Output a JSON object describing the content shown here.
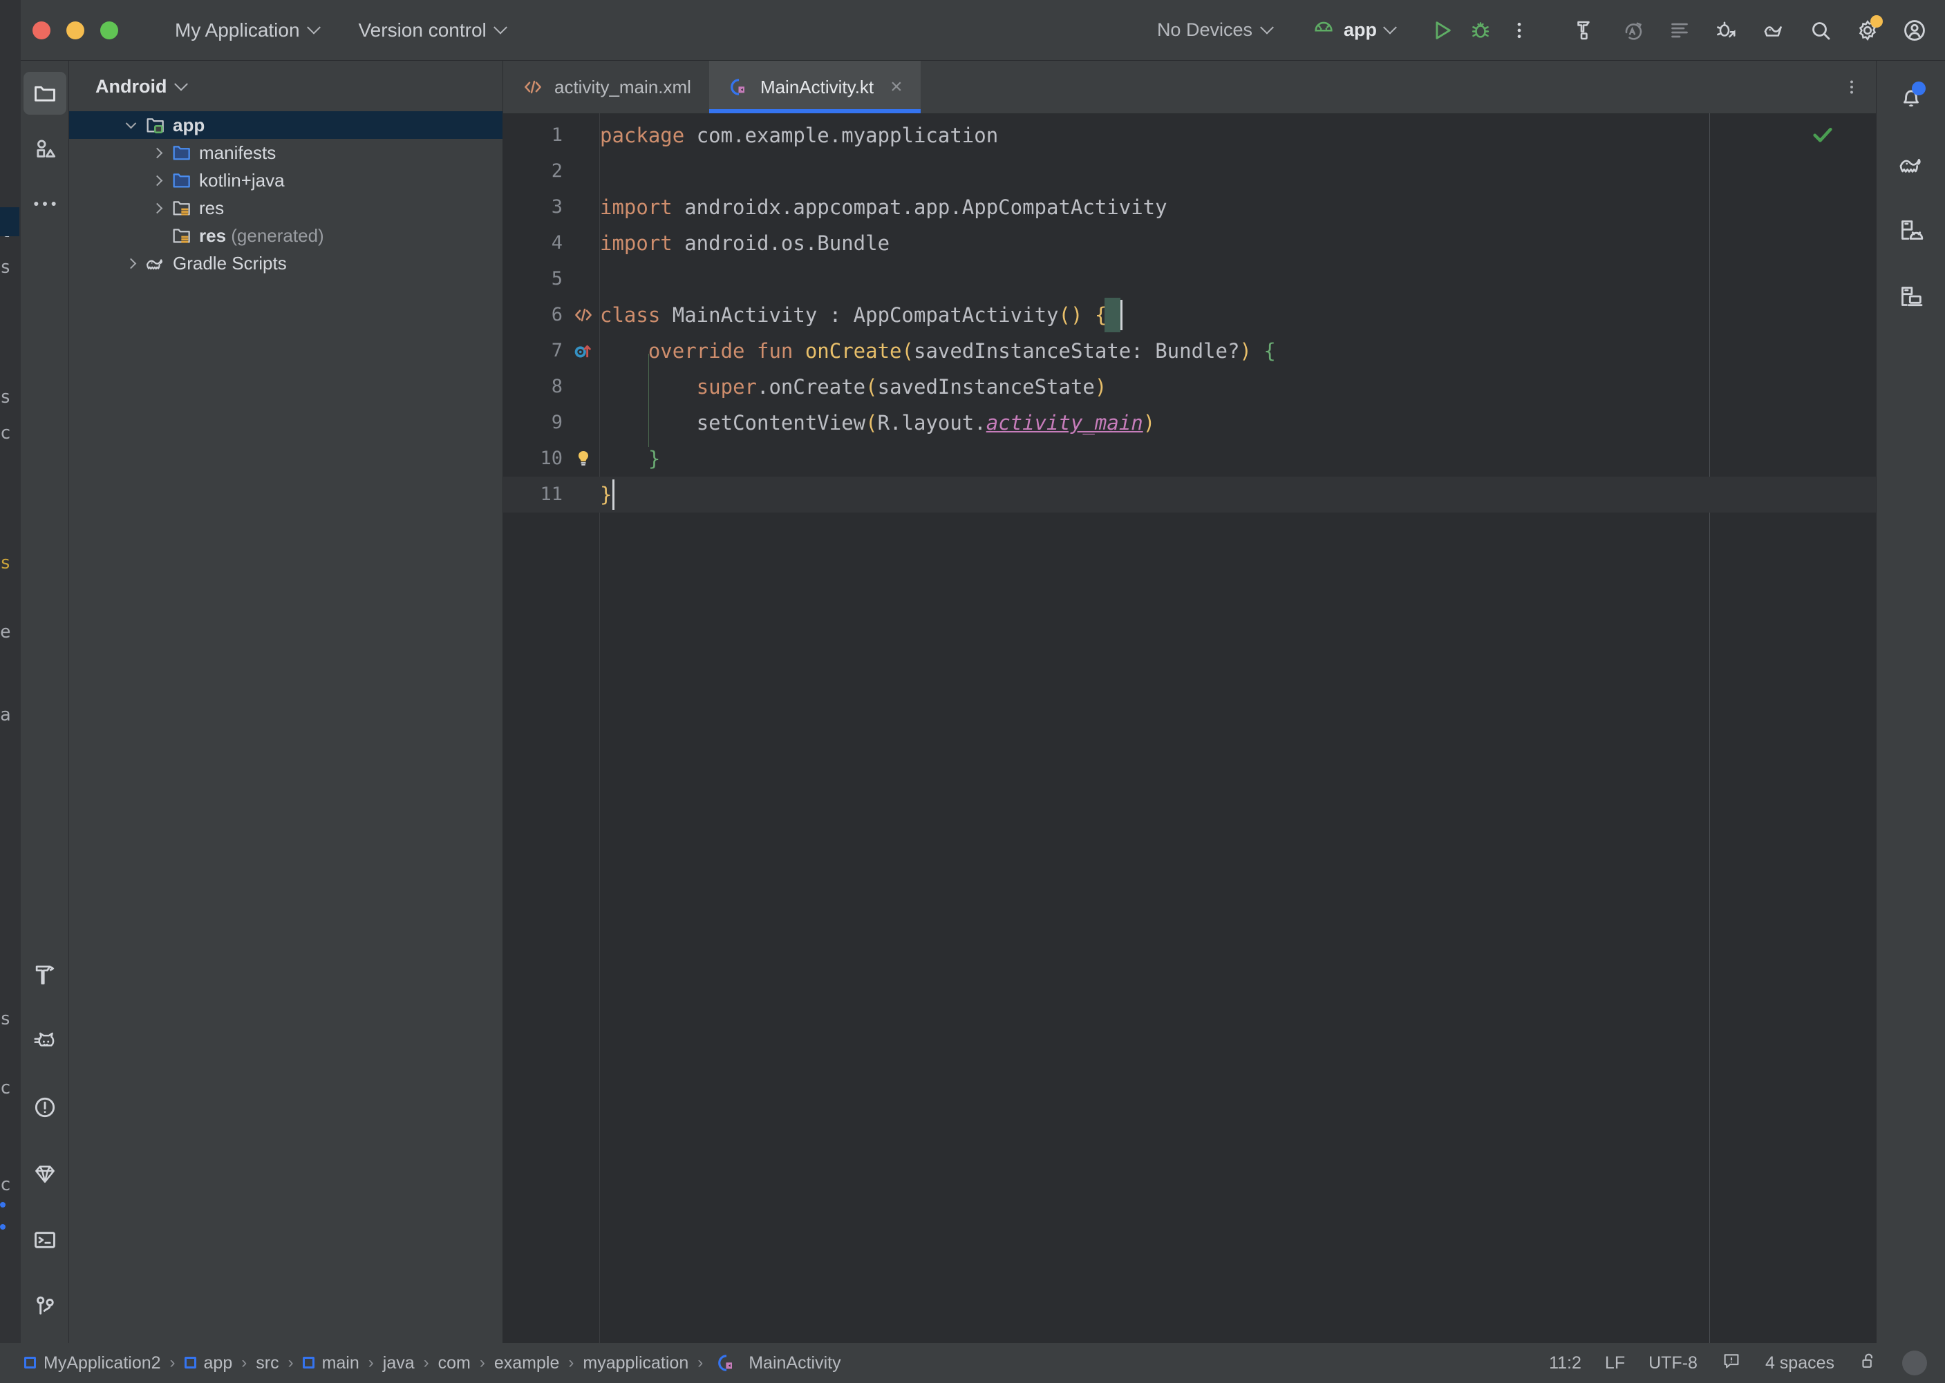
{
  "window": {
    "traffic_lights": [
      "close",
      "minimize",
      "maximize"
    ],
    "project_menu": "My Application",
    "vcs_menu": "Version control"
  },
  "toolbar": {
    "device_selector": "No Devices",
    "run_config": "app",
    "run_label": "Run",
    "debug_label": "Debug",
    "more_label": "More actions",
    "icons": [
      "build-icon",
      "apply-changes-icon",
      "logcat-icon",
      "debug-bridge-icon",
      "device-manager-icon",
      "search-icon",
      "settings-icon",
      "account-icon"
    ],
    "colors": {
      "run_green": "#5fad65",
      "accent_blue": "#3574f0",
      "badge_yellow": "#f5bd4f"
    }
  },
  "left_activity_bar": {
    "top": [
      "project-icon",
      "resource-manager-icon",
      "more-tool-windows-icon"
    ],
    "bottom": [
      "build-icon",
      "logcat-icon",
      "problems-icon",
      "profiler-icon",
      "terminal-icon",
      "version-control-icon"
    ],
    "selected": "project-icon"
  },
  "right_activity_bar": {
    "items": [
      "notifications-icon",
      "gradle-icon",
      "device-manager-icon",
      "running-devices-icon"
    ],
    "notification_badge": true,
    "badge_color": "#3574f0"
  },
  "project_panel": {
    "title": "Android",
    "tree": [
      {
        "label": "app",
        "icon": "module-folder-icon",
        "depth": 0,
        "arrow": "open",
        "selected": true,
        "bold": true
      },
      {
        "label": "manifests",
        "icon": "folder-blue-icon",
        "depth": 1,
        "arrow": "closed",
        "selected": false,
        "bold": false
      },
      {
        "label": "kotlin+java",
        "icon": "folder-blue-icon",
        "depth": 1,
        "arrow": "closed",
        "selected": false,
        "bold": false
      },
      {
        "label": "res",
        "icon": "res-folder-icon",
        "depth": 1,
        "arrow": "closed",
        "selected": false,
        "bold": false
      },
      {
        "label": "res",
        "suffix": " (generated)",
        "icon": "res-folder-icon",
        "depth": 1,
        "arrow": "none",
        "selected": false,
        "bold": true
      },
      {
        "label": "Gradle Scripts",
        "icon": "gradle-icon",
        "depth": 0,
        "arrow": "closed",
        "selected": false,
        "bold": false
      }
    ]
  },
  "editor": {
    "tabs": [
      {
        "label": "activity_main.xml",
        "icon": "xml-file-icon",
        "active": false,
        "closable": false
      },
      {
        "label": "MainActivity.kt",
        "icon": "kotlin-class-icon",
        "active": true,
        "closable": true,
        "close_glyph": "×"
      }
    ],
    "inspection_status": "ok",
    "inspection_color": "#4a9e52",
    "lines": [
      {
        "n": "1",
        "gutter": "none",
        "tokens": [
          {
            "t": "package ",
            "c": "kw"
          },
          {
            "t": "com.example.myapplication",
            "c": "id"
          }
        ]
      },
      {
        "n": "2",
        "gutter": "none",
        "tokens": []
      },
      {
        "n": "3",
        "gutter": "none",
        "tokens": [
          {
            "t": "import ",
            "c": "kw"
          },
          {
            "t": "androidx.appcompat.app.AppCompatActivity",
            "c": "id"
          }
        ]
      },
      {
        "n": "4",
        "gutter": "none",
        "tokens": [
          {
            "t": "import ",
            "c": "kw"
          },
          {
            "t": "android.os.Bundle",
            "c": "id"
          }
        ]
      },
      {
        "n": "5",
        "gutter": "none",
        "tokens": []
      },
      {
        "n": "6",
        "gutter": "code-class-icon",
        "tokens": [
          {
            "t": "class ",
            "c": "kw"
          },
          {
            "t": "MainActivity",
            "c": "id"
          },
          {
            "t": " : ",
            "c": "id"
          },
          {
            "t": "AppCompatActivity",
            "c": "id"
          },
          {
            "t": "(",
            "c": "brk"
          },
          {
            "t": ")",
            "c": "brk"
          },
          {
            "t": " ",
            "c": "id"
          },
          {
            "t": "{",
            "c": "brk"
          }
        ]
      },
      {
        "n": "7",
        "gutter": "override-method-icon",
        "tokens": [
          {
            "t": "    ",
            "c": "id"
          },
          {
            "t": "override fun ",
            "c": "kw"
          },
          {
            "t": "onCreate",
            "c": "fn"
          },
          {
            "t": "(",
            "c": "brk"
          },
          {
            "t": "savedInstanceState",
            "c": "id"
          },
          {
            "t": ": ",
            "c": "id"
          },
          {
            "t": "Bundle?",
            "c": "id"
          },
          {
            "t": ")",
            "c": "brk"
          },
          {
            "t": " ",
            "c": "id"
          },
          {
            "t": "{",
            "c": "brk2"
          }
        ]
      },
      {
        "n": "8",
        "gutter": "none",
        "tokens": [
          {
            "t": "        ",
            "c": "id"
          },
          {
            "t": "super",
            "c": "kw"
          },
          {
            "t": ".onCreate",
            "c": "id"
          },
          {
            "t": "(",
            "c": "brk"
          },
          {
            "t": "savedInstanceState",
            "c": "id"
          },
          {
            "t": ")",
            "c": "brk"
          }
        ]
      },
      {
        "n": "9",
        "gutter": "none",
        "tokens": [
          {
            "t": "        ",
            "c": "id"
          },
          {
            "t": "setContentView",
            "c": "id"
          },
          {
            "t": "(",
            "c": "brk"
          },
          {
            "t": "R.layout.",
            "c": "id"
          },
          {
            "t": "activity_main",
            "c": "res"
          },
          {
            "t": ")",
            "c": "brk"
          }
        ]
      },
      {
        "n": "10",
        "gutter": "intention-bulb-icon",
        "tokens": [
          {
            "t": "    ",
            "c": "id"
          },
          {
            "t": "}",
            "c": "brk2"
          }
        ]
      },
      {
        "n": "11",
        "gutter": "none",
        "tokens": [
          {
            "t": "}",
            "c": "brk"
          }
        ],
        "current": true
      }
    ]
  },
  "status_bar": {
    "breadcrumbs": [
      {
        "label": "MyApplication2",
        "icon": "module-icon"
      },
      {
        "label": "app",
        "icon": "module-icon"
      },
      {
        "label": "src",
        "icon": "none"
      },
      {
        "label": "main",
        "icon": "module-icon"
      },
      {
        "label": "java",
        "icon": "none"
      },
      {
        "label": "com",
        "icon": "none"
      },
      {
        "label": "example",
        "icon": "none"
      },
      {
        "label": "myapplication",
        "icon": "none"
      },
      {
        "label": "MainActivity",
        "icon": "kotlin-class-icon"
      }
    ],
    "separator": "›",
    "caret_position": "11:2",
    "line_separator": "LF",
    "encoding": "UTF-8",
    "read_only_toggle": "lock-open-icon",
    "indent": "4 spaces",
    "inspection_widget": "inspection-icon"
  }
}
